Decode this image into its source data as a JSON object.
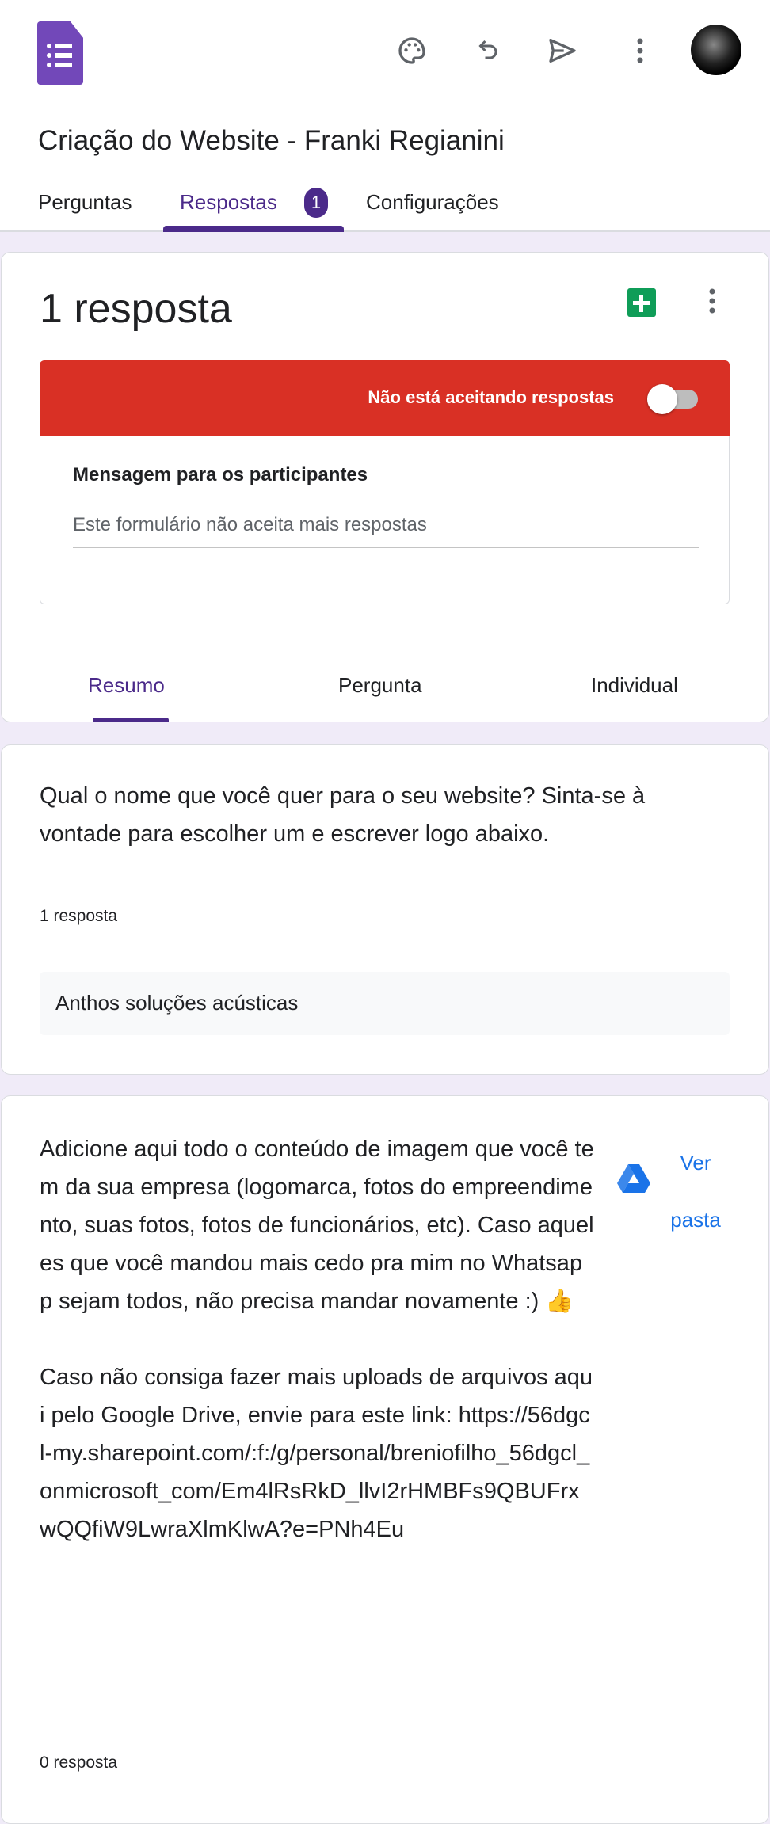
{
  "header": {
    "form_title": "Criação do Website - Franki Regianini",
    "icons": [
      "forms-logo-icon",
      "palette-icon",
      "undo-icon",
      "send-icon",
      "more-vert-icon",
      "avatar"
    ]
  },
  "tabs": [
    {
      "label": "Perguntas"
    },
    {
      "label": "Respostas",
      "badge": "1",
      "active": true
    },
    {
      "label": "Configurações"
    }
  ],
  "summary": {
    "count_label": "1 resposta",
    "banner_text": "Não está aceitando respostas",
    "accepting": false,
    "banner_color": "#d93025",
    "message_label": "Mensagem para os participantes",
    "message_value": "Este formulário não aceita mais respostas",
    "subtabs": [
      {
        "label": "Resumo",
        "active": true
      },
      {
        "label": "Pergunta"
      },
      {
        "label": "Individual"
      }
    ]
  },
  "questions": [
    {
      "text": "Qual o nome que você quer para o seu website? Sinta-se à vontade para escolher um e escrever logo abaixo.",
      "count": "1 resposta",
      "answers": [
        "Anthos soluções acústicas"
      ]
    },
    {
      "text": "Adicione aqui todo o conteúdo de imagem que você tem da sua empresa (logomarca, fotos do empreendimento, suas fotos, fotos de funcionários, etc). Caso aqueles que você mandou mais cedo pra mim no Whatsapp sejam todos, não precisa mandar novamente :) 👍\n\nCaso não consiga fazer mais uploads de arquivos aqui pelo Google Drive, envie para este link: https://56dgcl-my.sharepoint.com/:f:/g/personal/breniofilho_56dgcl_onmicrosoft_com/Em4lRsRkD_llvI2rHMBFs9QBUFrxwQQfiW9LwraXlmKlwA?e=PNh4Eu",
      "count": "0 resposta",
      "folder_link": "Ver pasta"
    }
  ],
  "accent": "#4b2a8a"
}
